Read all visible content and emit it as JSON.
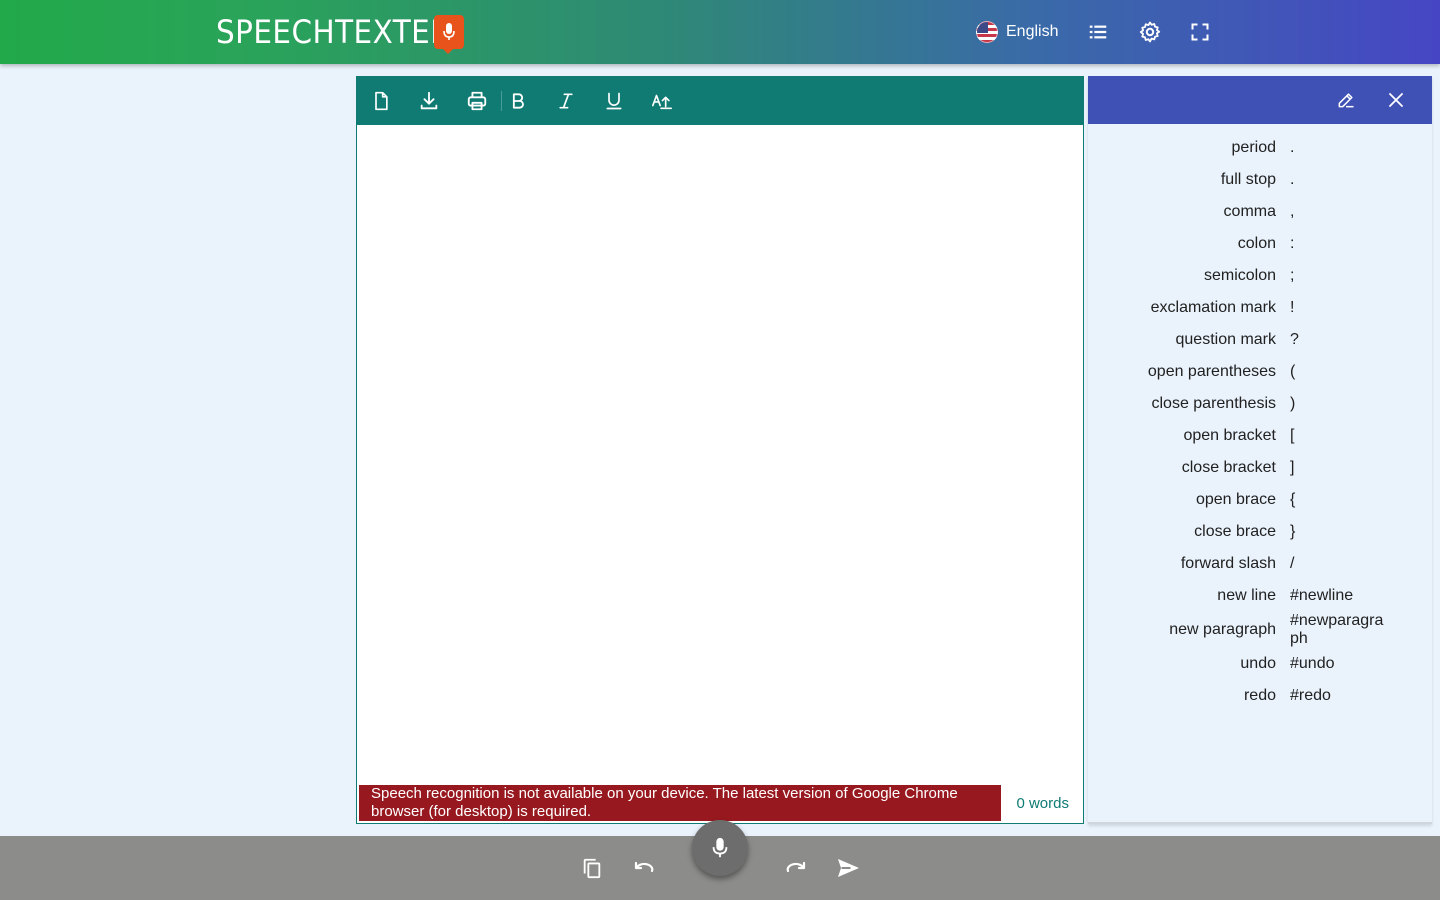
{
  "header": {
    "logo_text": "SPEECHTEXTER",
    "language": {
      "label": "English",
      "flag_icon": "us-flag-icon"
    },
    "icons": [
      "list-icon",
      "gear-icon",
      "fullscreen-icon"
    ]
  },
  "editor": {
    "toolbar": [
      "new-document-icon",
      "download-icon",
      "print-icon",
      "bold-icon",
      "italic-icon",
      "underline-icon",
      "text-size-icon"
    ],
    "content": "",
    "alert": "Speech recognition is not available on your device. The latest version of Google Chrome browser (for desktop) is required.",
    "word_count": "0 words"
  },
  "commands_panel": {
    "icons": [
      "edit-icon",
      "close-icon"
    ],
    "commands": [
      {
        "name": "period",
        "value": "."
      },
      {
        "name": "full stop",
        "value": "."
      },
      {
        "name": "comma",
        "value": ","
      },
      {
        "name": "colon",
        "value": ":"
      },
      {
        "name": "semicolon",
        "value": ";"
      },
      {
        "name": "exclamation mark",
        "value": "!"
      },
      {
        "name": "question mark",
        "value": "?"
      },
      {
        "name": "open parentheses",
        "value": "("
      },
      {
        "name": "close parenthesis",
        "value": ")"
      },
      {
        "name": "open bracket",
        "value": "["
      },
      {
        "name": "close bracket",
        "value": "]"
      },
      {
        "name": "open brace",
        "value": "{"
      },
      {
        "name": "close brace",
        "value": "}"
      },
      {
        "name": "forward slash",
        "value": "/"
      },
      {
        "name": "new line",
        "value": "#newline"
      },
      {
        "name": "new paragraph",
        "value": "#newparagraph"
      },
      {
        "name": "undo",
        "value": "#undo"
      },
      {
        "name": "redo",
        "value": "#redo"
      }
    ]
  },
  "bottom_bar": {
    "icons": [
      "copy-icon",
      "undo-icon",
      "microphone-icon",
      "redo-icon",
      "send-icon"
    ]
  },
  "colors": {
    "toolbar": "#0f7b73",
    "panel_header": "#3f51b5",
    "alert": "#97191f",
    "bottom_bar": "#8c8c8a",
    "logo_mic": "#e8531b"
  }
}
